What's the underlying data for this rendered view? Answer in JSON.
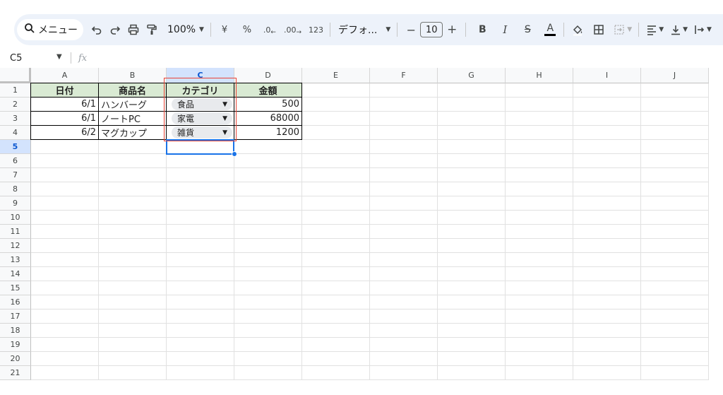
{
  "toolbar": {
    "search_label": "メニュー",
    "zoom": "100%",
    "currency": "¥",
    "percent": "%",
    "dec_decrease": ".0",
    "dec_increase": ".00",
    "number_format": "123",
    "font_name": "デフォ...",
    "font_size": "10",
    "minus": "−",
    "plus": "+",
    "bold": "B",
    "italic": "I",
    "strike": "S",
    "text_color": "A"
  },
  "formula_bar": {
    "cell_ref": "C5",
    "fx": "fx"
  },
  "columns": [
    "A",
    "B",
    "C",
    "D",
    "E",
    "F",
    "G",
    "H",
    "I",
    "J"
  ],
  "rows": [
    "1",
    "2",
    "3",
    "4",
    "5",
    "6",
    "7",
    "8",
    "9",
    "10",
    "11",
    "12",
    "13",
    "14",
    "15",
    "16",
    "17",
    "18",
    "19",
    "20",
    "21"
  ],
  "table": {
    "headers": [
      "日付",
      "商品名",
      "カテゴリ",
      "金額"
    ],
    "rows": [
      {
        "date": "6/1",
        "product": "ハンバーグ",
        "category": "食品",
        "amount": "500"
      },
      {
        "date": "6/1",
        "product": "ノートPC",
        "category": "家電",
        "amount": "68000"
      },
      {
        "date": "6/2",
        "product": "マグカップ",
        "category": "雑貨",
        "amount": "1200"
      }
    ]
  },
  "selected_cell": "C5",
  "colors": {
    "header_fill": "#d9ead3",
    "selection": "#1a73e8",
    "highlight_box": "#ea4335",
    "toolbar_bg": "#edf2fa"
  }
}
